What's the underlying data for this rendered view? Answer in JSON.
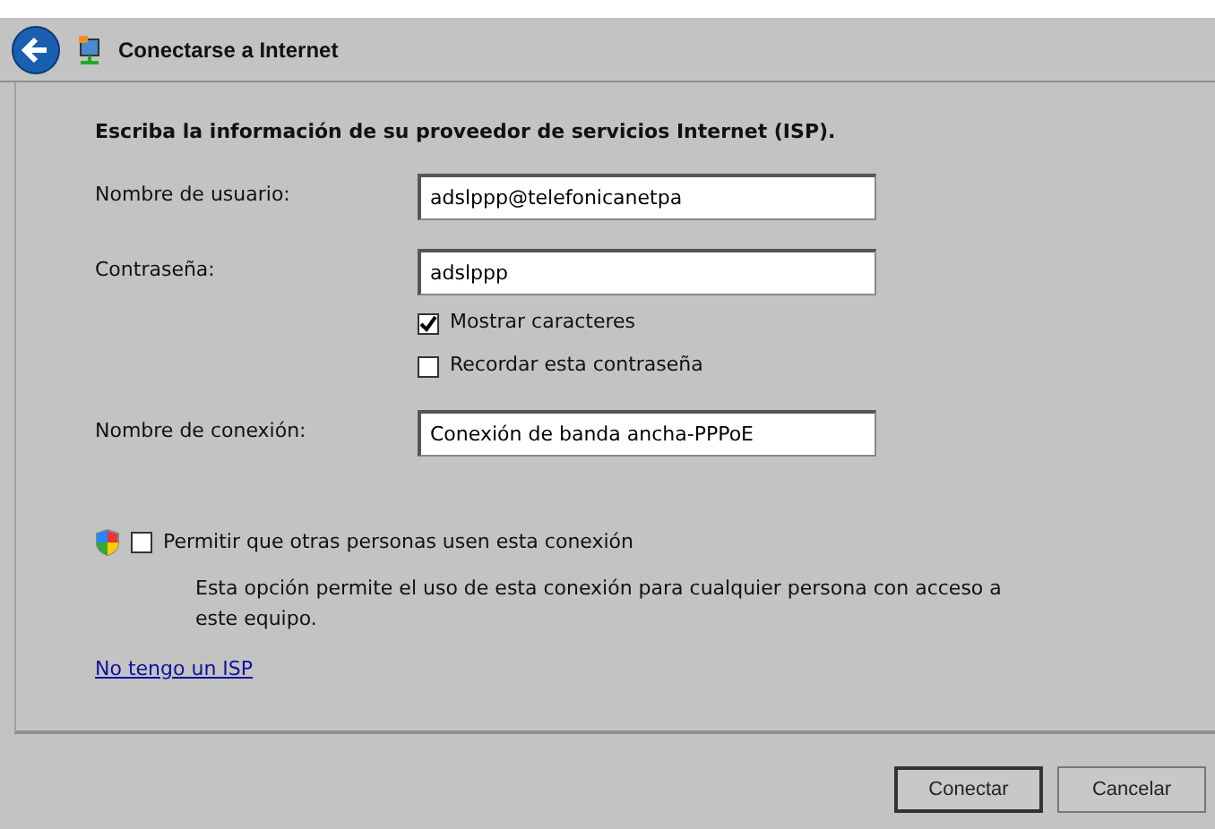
{
  "window": {
    "title": "Conectarse a Internet"
  },
  "heading": "Escriba la información de su proveedor de servicios Internet (ISP).",
  "fields": [
    {
      "kind": "text",
      "label": "Nombre de usuario:",
      "value": "adslppp@telefonicanetpa"
    },
    {
      "kind": "text",
      "label": "Contraseña:",
      "value": "adslppp"
    },
    {
      "kind": "checkbox",
      "label": "Mostrar caracteres",
      "checked": true
    },
    {
      "kind": "checkbox",
      "label": "Recordar esta contraseña",
      "checked": false
    },
    {
      "kind": "text",
      "label": "Nombre de conexión:",
      "value": "Conexión de banda ancha-PPPoE"
    }
  ],
  "share": {
    "label": "Permitir que otras personas usen esta conexión",
    "checked": false,
    "description": "Esta opción permite el uso de esta conexión para cualquier persona con acceso a este equipo."
  },
  "link": "No tengo un ISP",
  "buttons": [
    {
      "label": "Conectar",
      "default": true
    },
    {
      "label": "Cancelar",
      "default": false
    }
  ]
}
